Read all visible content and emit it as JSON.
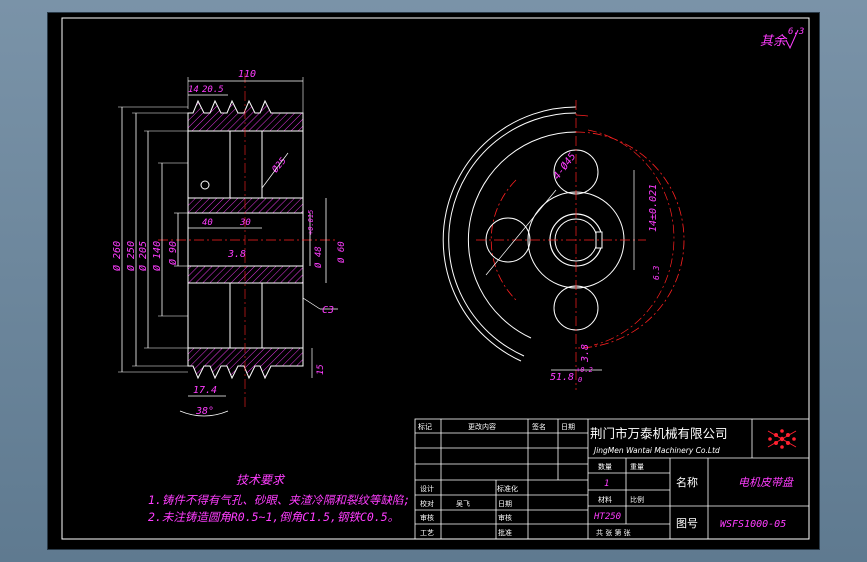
{
  "roughness_note": "其余",
  "roughness_value": "6.3",
  "front_view": {
    "dim_top_width": "110",
    "dim_groove_a": "14",
    "dim_groove_b": "20.5",
    "dia_260": "Ø 260",
    "dia_250": "Ø 250",
    "dia_205": "Ø 205",
    "dia_140": "Ø 140",
    "dia_90": "Ø 90",
    "dim_40": "40",
    "dim_30": "30",
    "dim_3_8": "3.8",
    "dia_48": "Ø 48",
    "tol_48": "+0.015",
    "dia_60": "Ø 60",
    "dia_25": "Ø25",
    "chamfer": "C3",
    "dim_17_4": "17.4",
    "angle_38": "38°",
    "dim_15": "15"
  },
  "side_view": {
    "holes_label": "4-Ø45",
    "keyway_width": "14±0.021",
    "keyway_depth": "51.8",
    "keyway_depth_tol": "+0.2",
    "keyway_depth_tol2": "0",
    "dim_3_8": "3.8",
    "rough_63": "6.3"
  },
  "tech_requirements": {
    "title": "技术要求",
    "line1": "1.铸件不得有气孔、砂眼、夹渣冷隔和裂纹等缺陷;",
    "line2": "2.未注铸造圆角R0.5~1,倒角C1.5,钢铁C0.5。"
  },
  "title_block": {
    "rev_mark": "标记",
    "rev_content": "更改内容",
    "rev_sign": "签名",
    "rev_date": "日期",
    "company_cn": "荆门市万泰机械有限公司",
    "company_en": "JingMen Wantai Machinery Co.Ltd",
    "qty_label": "数量",
    "weight_label": "重量",
    "qty_value": "1",
    "material_label": "材料",
    "scale_label": "比例",
    "material_value": "HT250",
    "name_label": "名称",
    "name_value": "电机皮带盘",
    "drawing_no_label": "图号",
    "drawing_no_value": "WSFS1000-05",
    "design": "设计",
    "designer": "吴飞",
    "standard": "标准化",
    "check": "校对",
    "date": "日期",
    "review": "审核",
    "verify": "审核",
    "process": "工艺",
    "approve": "批准",
    "sheets": "共 张 第 张"
  }
}
